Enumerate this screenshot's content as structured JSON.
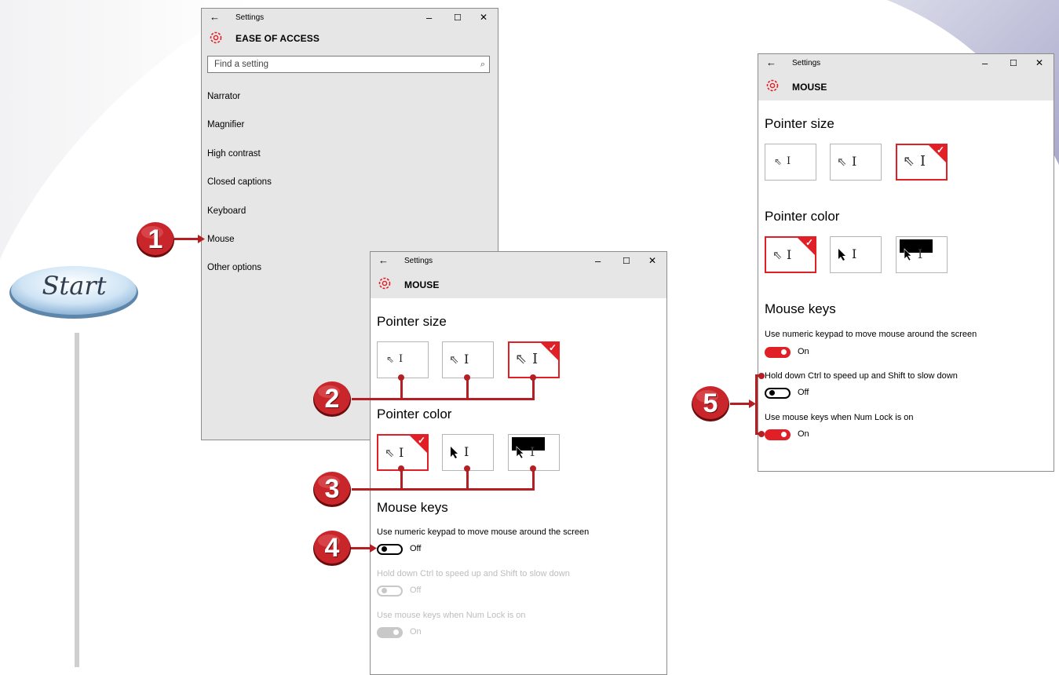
{
  "colors": {
    "accent": "#e01f26",
    "callout": "#b51f24"
  },
  "start_label": "Start",
  "steps": [
    "1",
    "2",
    "3",
    "4",
    "5"
  ],
  "window1": {
    "titlebar": {
      "back": "←",
      "title": "Settings",
      "minimize": "–",
      "maximize": "☐",
      "close": "✕"
    },
    "header": "EASE OF ACCESS",
    "search_placeholder": "Find a setting",
    "nav": [
      "Narrator",
      "Magnifier",
      "High contrast",
      "Closed captions",
      "Keyboard",
      "Mouse",
      "Other options"
    ]
  },
  "window2": {
    "titlebar": {
      "back": "←",
      "title": "Settings",
      "minimize": "–",
      "maximize": "☐",
      "close": "✕"
    },
    "header": "MOUSE",
    "pointer_size": "Pointer size",
    "pointer_color": "Pointer color",
    "mouse_keys": "Mouse keys",
    "settings": [
      {
        "label": "Use numeric keypad to move mouse around the screen",
        "state": "Off"
      },
      {
        "label": "Hold down Ctrl to speed up and Shift to slow down",
        "state": "Off"
      },
      {
        "label": "Use mouse keys when Num Lock is on",
        "state": "On"
      }
    ]
  },
  "window3": {
    "titlebar": {
      "back": "←",
      "title": "Settings",
      "minimize": "–",
      "maximize": "☐",
      "close": "✕"
    },
    "header": "MOUSE",
    "pointer_size": "Pointer size",
    "pointer_color": "Pointer color",
    "mouse_keys": "Mouse keys",
    "settings": [
      {
        "label": "Use numeric keypad to move mouse around the screen",
        "state": "On"
      },
      {
        "label": "Hold down Ctrl to speed up and Shift to slow down",
        "state": "Off"
      },
      {
        "label": "Use mouse keys when Num Lock is on",
        "state": "On"
      }
    ]
  },
  "glyphs": {
    "arrow_outline": "⇖",
    "arrow_black": "➤",
    "ibeam": "I",
    "check": "✓",
    "search": "⌕"
  }
}
